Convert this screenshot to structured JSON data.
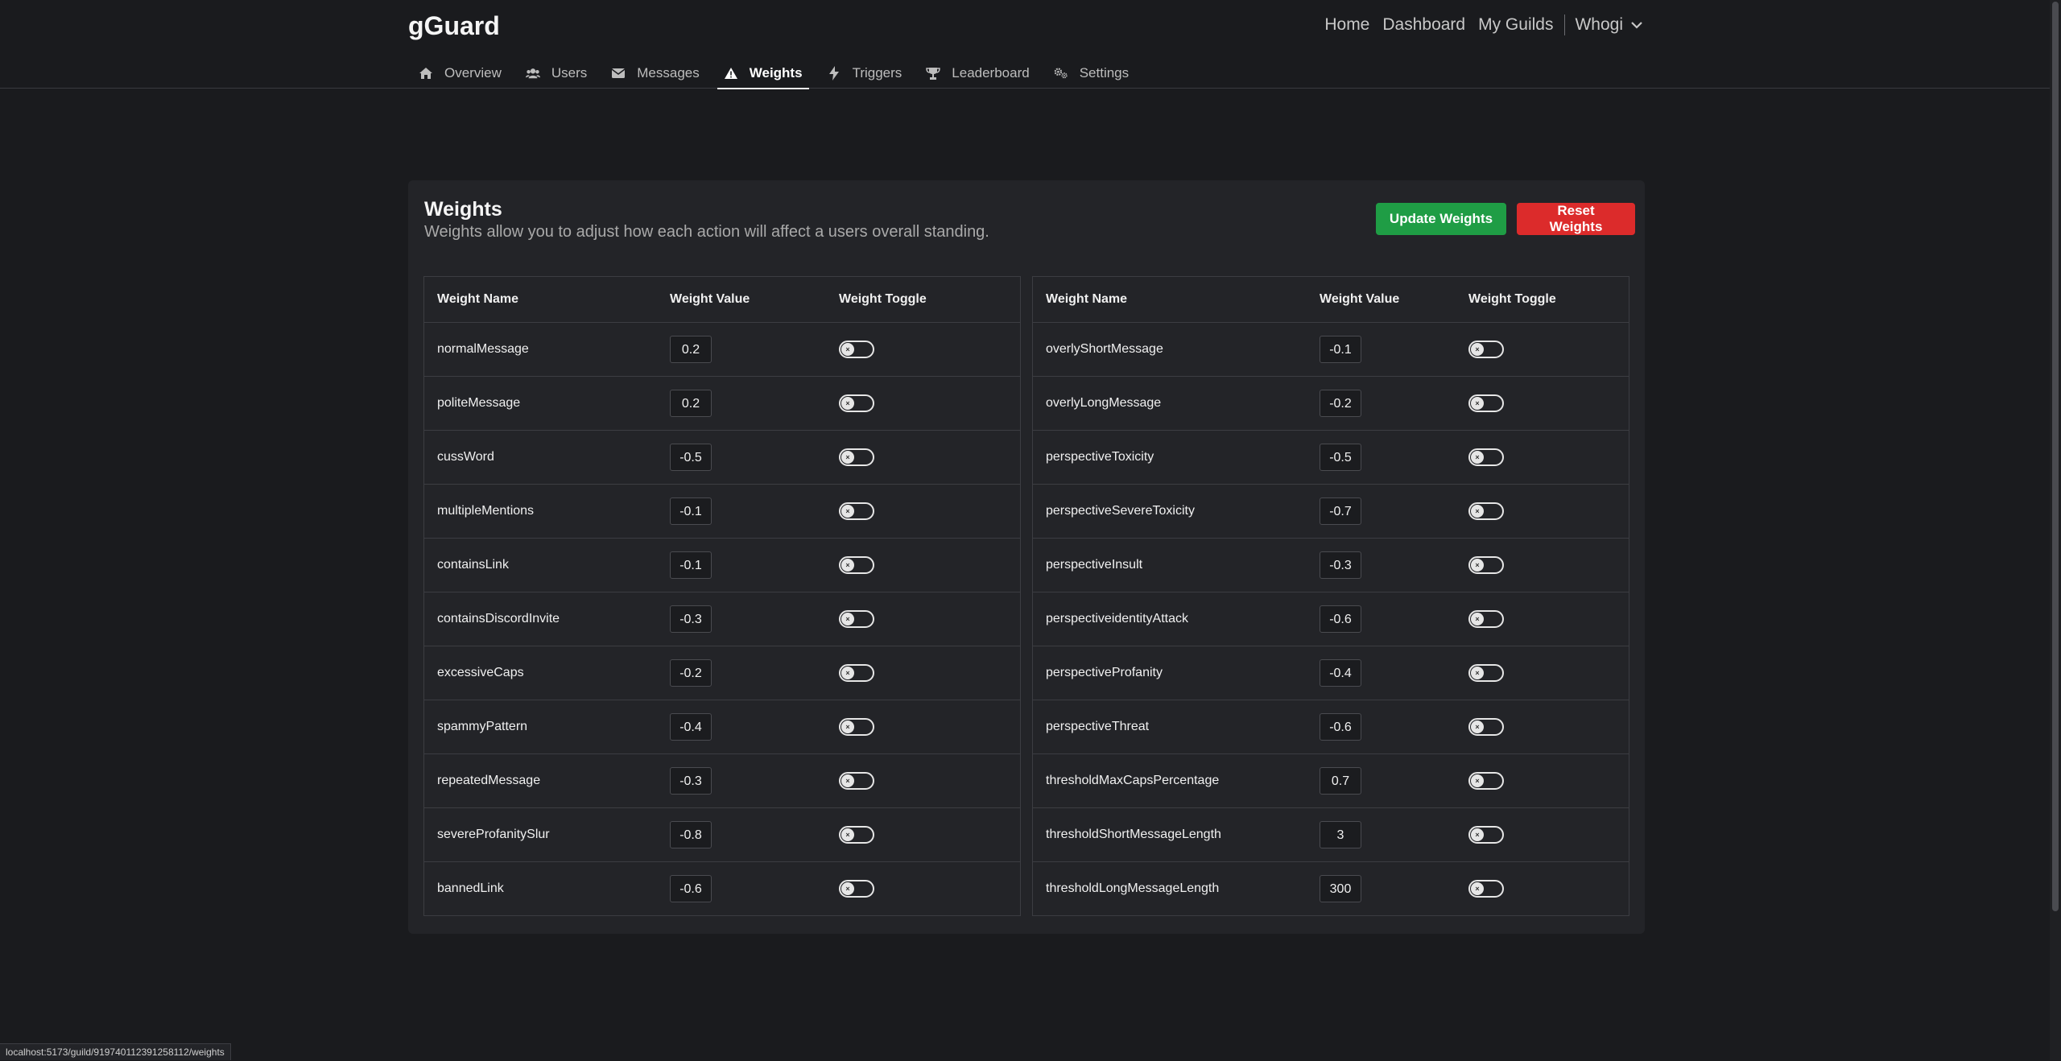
{
  "brand": "gGuard",
  "top_nav": {
    "home": "Home",
    "dashboard": "Dashboard",
    "my_guilds": "My Guilds",
    "user": "Whogi"
  },
  "tabs": [
    {
      "label": "Overview",
      "icon": "home-icon"
    },
    {
      "label": "Users",
      "icon": "users-icon"
    },
    {
      "label": "Messages",
      "icon": "envelope-icon"
    },
    {
      "label": "Weights",
      "icon": "warning-icon",
      "active": true
    },
    {
      "label": "Triggers",
      "icon": "bolt-icon"
    },
    {
      "label": "Leaderboard",
      "icon": "trophy-icon"
    },
    {
      "label": "Settings",
      "icon": "gears-icon"
    }
  ],
  "card": {
    "title": "Weights",
    "subtitle": "Weights allow you to adjust how each action will affect a users overall standing.",
    "update_label": "Update Weights",
    "reset_label": "Reset Weights"
  },
  "columns": {
    "name": "Weight Name",
    "value": "Weight Value",
    "toggle": "Weight Toggle"
  },
  "left_rows": [
    {
      "name": "normalMessage",
      "value": "0.2",
      "enabled": false
    },
    {
      "name": "politeMessage",
      "value": "0.2",
      "enabled": false
    },
    {
      "name": "cussWord",
      "value": "-0.5",
      "enabled": false
    },
    {
      "name": "multipleMentions",
      "value": "-0.1",
      "enabled": false
    },
    {
      "name": "containsLink",
      "value": "-0.1",
      "enabled": false
    },
    {
      "name": "containsDiscordInvite",
      "value": "-0.3",
      "enabled": false
    },
    {
      "name": "excessiveCaps",
      "value": "-0.2",
      "enabled": false
    },
    {
      "name": "spammyPattern",
      "value": "-0.4",
      "enabled": false
    },
    {
      "name": "repeatedMessage",
      "value": "-0.3",
      "enabled": false
    },
    {
      "name": "severeProfanitySlur",
      "value": "-0.8",
      "enabled": false
    },
    {
      "name": "bannedLink",
      "value": "-0.6",
      "enabled": false
    }
  ],
  "right_rows": [
    {
      "name": "overlyShortMessage",
      "value": "-0.1",
      "enabled": false
    },
    {
      "name": "overlyLongMessage",
      "value": "-0.2",
      "enabled": false
    },
    {
      "name": "perspectiveToxicity",
      "value": "-0.5",
      "enabled": false
    },
    {
      "name": "perspectiveSevereToxicity",
      "value": "-0.7",
      "enabled": false
    },
    {
      "name": "perspectiveInsult",
      "value": "-0.3",
      "enabled": false
    },
    {
      "name": "perspectiveidentityAttack",
      "value": "-0.6",
      "enabled": false
    },
    {
      "name": "perspectiveProfanity",
      "value": "-0.4",
      "enabled": false
    },
    {
      "name": "perspectiveThreat",
      "value": "-0.6",
      "enabled": false
    },
    {
      "name": "thresholdMaxCapsPercentage",
      "value": "0.7",
      "enabled": false
    },
    {
      "name": "thresholdShortMessageLength",
      "value": "3",
      "enabled": false
    },
    {
      "name": "thresholdLongMessageLength",
      "value": "300",
      "enabled": false
    }
  ],
  "status_url": "localhost:5173/guild/919740112391258112/weights",
  "colors": {
    "background": "#1a1b1e",
    "card": "#232428",
    "update": "#1f9d45",
    "reset": "#dc2b2b"
  }
}
